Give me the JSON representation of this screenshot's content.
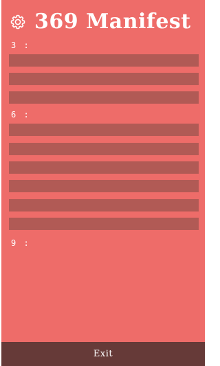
{
  "header": {
    "title": "369 Manifest",
    "settings_icon": "gear-icon"
  },
  "sections": [
    {
      "label": "3 :",
      "entry_count": 3
    },
    {
      "label": "6 :",
      "entry_count": 6
    },
    {
      "label": "9 :",
      "entry_count": 0
    }
  ],
  "footer": {
    "exit_label": "Exit"
  },
  "colors": {
    "background": "#ee6c69",
    "entry": "#b15a55",
    "footer": "#663a38",
    "text": "#ffffff"
  }
}
